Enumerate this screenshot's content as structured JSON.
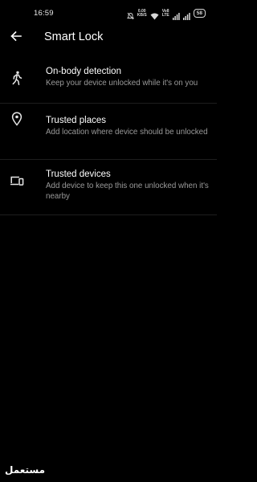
{
  "status_bar": {
    "time": "16:59",
    "net_speed_value": "0.00",
    "net_speed_unit": "KB/S",
    "volte_top": "Vo8",
    "volte_bottom": "LTE",
    "battery": "58"
  },
  "app_bar": {
    "back_icon": "arrow-left-icon",
    "title": "Smart Lock"
  },
  "settings": {
    "items": [
      {
        "icon": "walking-person-icon",
        "title": "On-body detection",
        "description": "Keep your device unlocked while it's on you"
      },
      {
        "icon": "location-pin-icon",
        "title": "Trusted places",
        "description": "Add location where device should be unlocked"
      },
      {
        "icon": "devices-icon",
        "title": "Trusted devices",
        "description": "Add device to keep this one unlocked when it's nearby"
      }
    ]
  },
  "watermark": {
    "text": "مستعمل"
  },
  "colors": {
    "background": "#000000",
    "title_text": "#ffffff",
    "secondary_text": "#9a9a9a",
    "divider": "#1e1e1e"
  }
}
